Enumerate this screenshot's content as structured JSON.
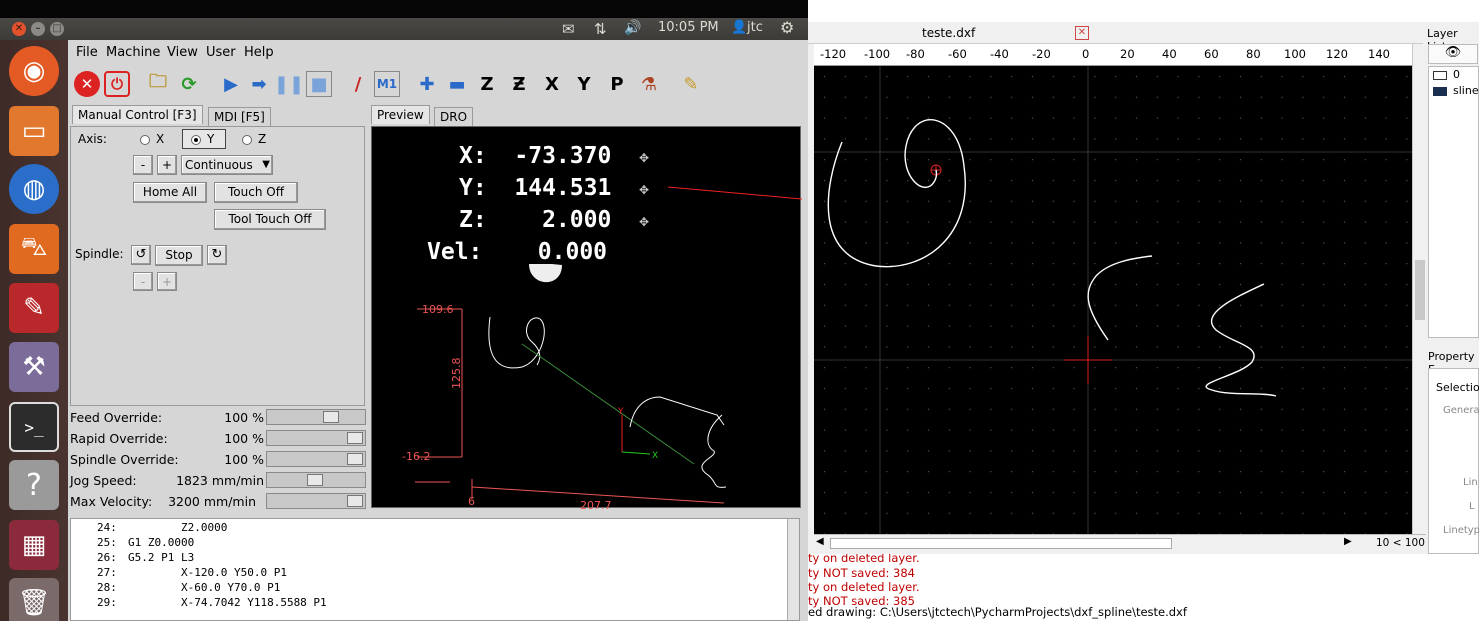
{
  "panel": {
    "time": "10:05 PM",
    "user": "jtc",
    "icons": [
      "mail-icon",
      "network-icon",
      "volume-icon",
      "user-icon",
      "settings-gear-icon"
    ]
  },
  "launcher": {
    "items": [
      "ubuntu-logo-icon",
      "files-icon",
      "firefox-icon",
      "software-center-icon",
      "system-settings-icon",
      "linuxcnc-icon",
      "terminal-icon",
      "help-icon",
      "workspace-switcher-icon",
      "trash-icon"
    ]
  },
  "linuxcnc": {
    "menu": [
      "File",
      "Machine",
      "View",
      "User",
      "Help"
    ],
    "toolbar_icons": [
      "estop-icon",
      "power-icon",
      "open-file-icon",
      "reload-icon",
      "run-icon",
      "step-icon",
      "pause-icon",
      "stop-icon",
      "block-delete-icon",
      "optional-stop-icon",
      "zoom-in-icon",
      "zoom-out-icon",
      "view-z-icon",
      "view-z2-icon",
      "view-x-icon",
      "view-y-icon",
      "view-p-icon",
      "rotate-view-icon",
      "clear-plot-icon"
    ],
    "tabs": {
      "manual": "Manual Control [F3]",
      "mdi": "MDI [F5]",
      "preview": "Preview",
      "dro": "DRO"
    },
    "axis_label": "Axis:",
    "axes": [
      "X",
      "Y",
      "Z"
    ],
    "selected_axis": "Y",
    "jog_minus": "-",
    "jog_plus": "+",
    "jog_mode": "Continuous",
    "home_all": "Home All",
    "touch_off": "Touch Off",
    "tool_touch_off": "Tool Touch Off",
    "spindle_label": "Spindle:",
    "spindle_stop": "Stop",
    "overrides": [
      {
        "label": "Feed Override:",
        "value": "100 %",
        "level": 0.7
      },
      {
        "label": "Rapid Override:",
        "value": "100 %",
        "level": 1.0
      },
      {
        "label": "Spindle Override:",
        "value": "100 %",
        "level": 1.0
      },
      {
        "label": "Jog Speed:",
        "value": "1823 mm/min",
        "level": 0.5
      },
      {
        "label": "Max Velocity:",
        "value": "3200 mm/min",
        "level": 1.0
      }
    ],
    "dro": {
      "x": "X:  -73.370",
      "y": "Y:  144.531",
      "z": "Z:    2.000",
      "vel": "Vel:    0.000"
    },
    "dims": {
      "ymax": "109.6",
      "yspan": "125.8",
      "ymin": "-16.2",
      "xmin": "6",
      "xspan": "207.7"
    },
    "gcode": [
      {
        "n": "24:",
        "code": "        Z2.0000"
      },
      {
        "n": "25:",
        "code": "G1 Z0.0000"
      },
      {
        "n": "26:",
        "code": "G5.2 P1 L3"
      },
      {
        "n": "27:",
        "code": "        X-120.0 Y50.0 P1"
      },
      {
        "n": "28:",
        "code": "        X-60.0 Y70.0 P1"
      },
      {
        "n": "29:",
        "code": "        X-74.7042 Y118.5588 P1"
      }
    ]
  },
  "cad": {
    "tab_title": "teste.dxf",
    "layer_list_title": "Layer List",
    "layers": [
      "0",
      "sline"
    ],
    "property_title": "Property E",
    "selection_label": "Selection",
    "general_label": "Genera",
    "prop_labels": [
      "Lin",
      "L",
      "Linetyp"
    ],
    "ruler": [
      "-120",
      "-100",
      "-80",
      "-60",
      "-40",
      "-20",
      "0",
      "20",
      "40",
      "60",
      "80",
      "100",
      "120",
      "140"
    ],
    "zoom": "10 < 100",
    "messages": [
      "ty on deleted layer.",
      "ty NOT saved: 384",
      "ty on deleted layer.",
      "ty NOT saved: 385",
      "ed drawing: C:\\Users\\jtctech\\PycharmProjects\\dxf_spline\\teste.dxf"
    ]
  }
}
